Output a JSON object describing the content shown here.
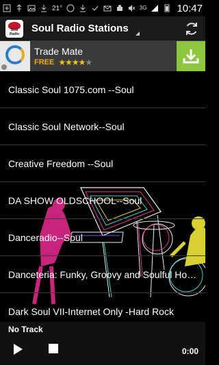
{
  "statusbar": {
    "temperature": "21°",
    "network": "3G",
    "time": "10:47"
  },
  "actionbar": {
    "app_icon_text": "Soul Radio",
    "title": "Soul Radio Stations"
  },
  "ad": {
    "title": "Trade Mate",
    "price": "FREE",
    "rating": 4
  },
  "stations": [
    "Classic Soul 1075.com --Soul",
    "Classic Soul Network--Soul",
    "Creative Freedom --Soul",
    "DA SHOW OLDSCHOOL--Soul",
    "Danceradio--Soul",
    "Danceteria: Funky, Groovy and Soulful House Music--Soul",
    "Dark Soul VII-Internet Only -Hard Rock"
  ],
  "player": {
    "track": "No Track",
    "time": "0:00"
  },
  "colors": {
    "ad_free": "#f2a81f",
    "download_bg": "#8ec63f",
    "accent_refresh": "#dddddd"
  }
}
